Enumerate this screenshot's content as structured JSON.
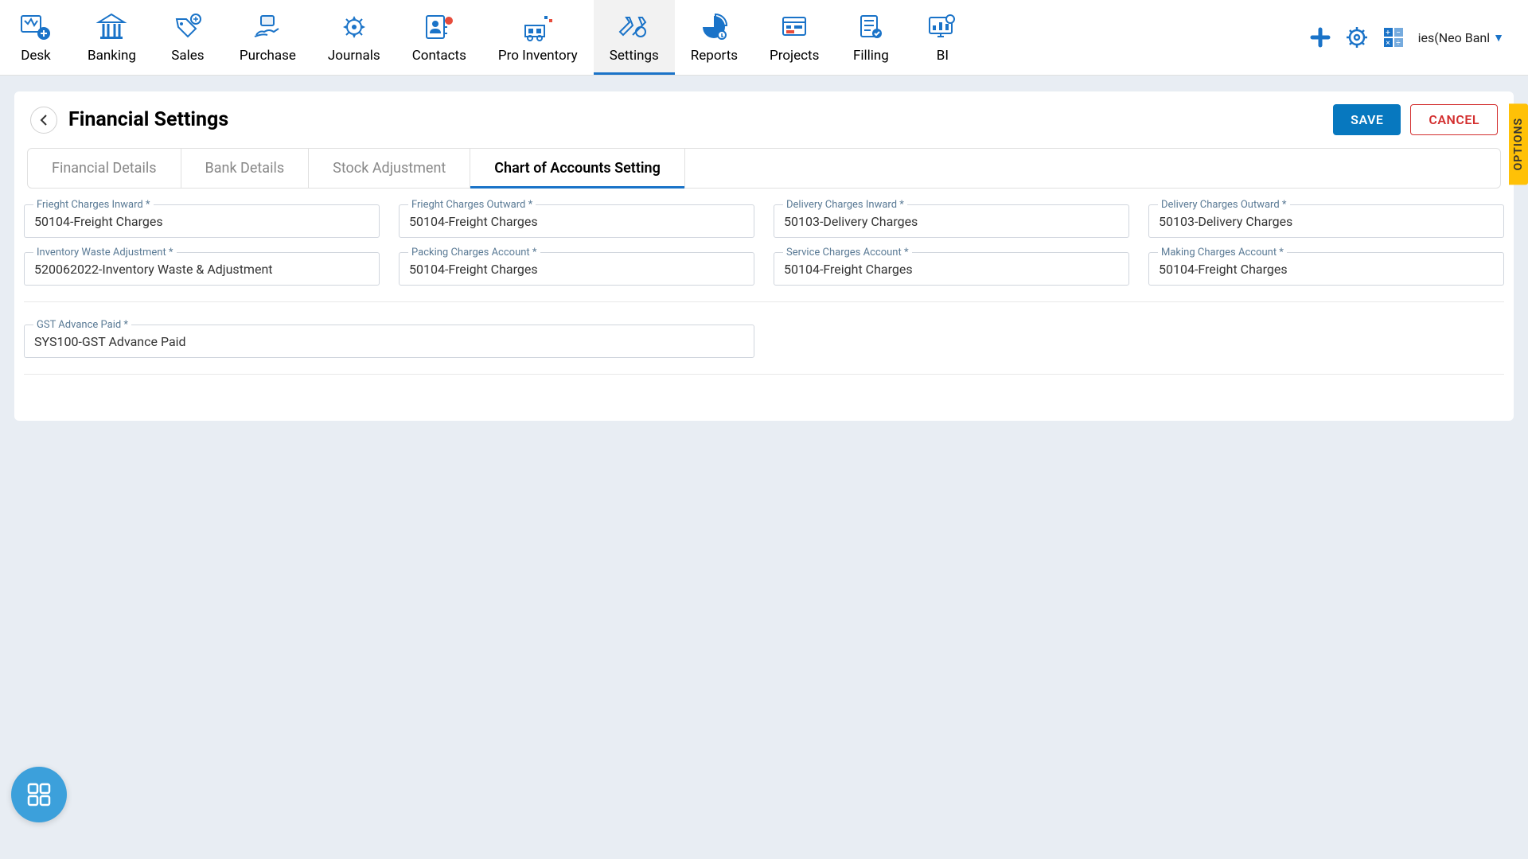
{
  "nav": {
    "items": [
      {
        "label": "Desk"
      },
      {
        "label": "Banking"
      },
      {
        "label": "Sales"
      },
      {
        "label": "Purchase"
      },
      {
        "label": "Journals"
      },
      {
        "label": "Contacts"
      },
      {
        "label": "Pro Inventory"
      },
      {
        "label": "Settings"
      },
      {
        "label": "Reports"
      },
      {
        "label": "Projects"
      },
      {
        "label": "Filling"
      },
      {
        "label": "BI"
      }
    ],
    "account_label": "ies(Neo Banl"
  },
  "page": {
    "title": "Financial Settings",
    "save_label": "SAVE",
    "cancel_label": "CANCEL",
    "options_label": "OPTIONS"
  },
  "tabs": [
    {
      "label": "Financial Details"
    },
    {
      "label": "Bank Details"
    },
    {
      "label": "Stock Adjustment"
    },
    {
      "label": "Chart of Accounts Setting"
    }
  ],
  "fields": {
    "freight_inward": {
      "label": "Frieght Charges Inward *",
      "value": "50104-Freight Charges"
    },
    "freight_outward": {
      "label": "Frieght Charges Outward *",
      "value": "50104-Freight Charges"
    },
    "delivery_inward": {
      "label": "Delivery Charges Inward *",
      "value": "50103-Delivery Charges"
    },
    "delivery_outward": {
      "label": "Delivery Charges Outward *",
      "value": "50103-Delivery Charges"
    },
    "inventory_waste": {
      "label": "Inventory Waste Adjustment *",
      "value": "520062022-Inventory Waste & Adjustment"
    },
    "packing": {
      "label": "Packing Charges Account *",
      "value": "50104-Freight Charges"
    },
    "service": {
      "label": "Service Charges Account *",
      "value": "50104-Freight Charges"
    },
    "making": {
      "label": "Making Charges Account *",
      "value": "50104-Freight Charges"
    },
    "gst_advance": {
      "label": "GST Advance Paid *",
      "value": "SYS100-GST Advance Paid"
    }
  }
}
